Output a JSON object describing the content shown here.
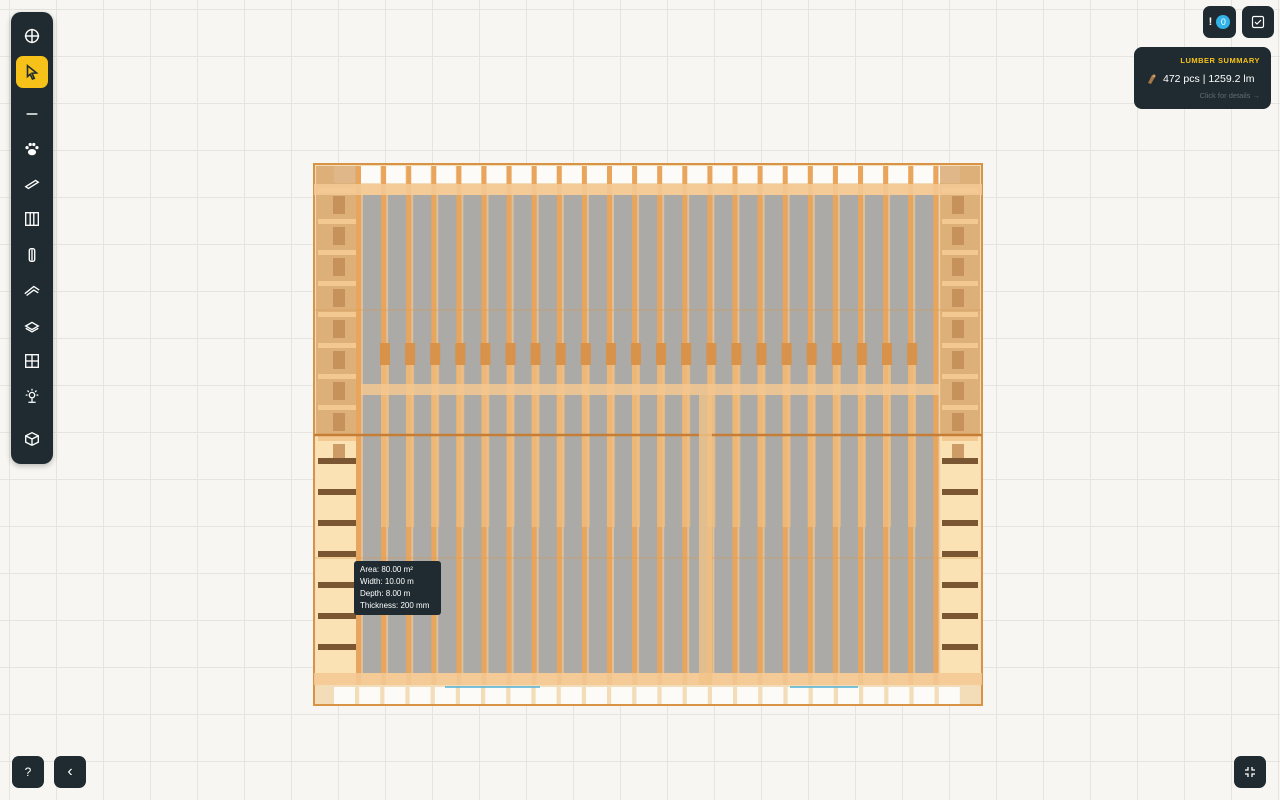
{
  "toolbar": {
    "tools": [
      {
        "name": "pan-icon"
      },
      {
        "name": "select-icon",
        "active": true
      },
      {
        "name": "line-icon"
      },
      {
        "name": "paw-icon"
      },
      {
        "name": "beam-icon"
      },
      {
        "name": "wall-icon"
      },
      {
        "name": "post-icon"
      },
      {
        "name": "roof-icon"
      },
      {
        "name": "floor-icon"
      },
      {
        "name": "window-icon"
      },
      {
        "name": "light-icon"
      },
      {
        "name": "3d-view-icon"
      }
    ]
  },
  "top_right": {
    "alert_symbol": "!",
    "alert_count": "0"
  },
  "lumber_summary": {
    "title": "LUMBER SUMMARY",
    "value": "472 pcs | 1259.2 lm",
    "link": "Click for details →"
  },
  "tooltip": {
    "area": "Area: 80.00 m²",
    "width": "Width: 10.00 m",
    "depth": "Depth: 8.00 m",
    "thickness": "Thickness: 200 mm"
  },
  "bottom": {
    "help_label": "?",
    "collapse_label": "‹"
  },
  "colors": {
    "toolbar_bg": "#1f2b30",
    "accent": "#f6c21a",
    "wood": "#e9a55c",
    "wood_light": "#f7d49f",
    "slab": "#a6a6a6",
    "badge": "#31b3e8"
  }
}
